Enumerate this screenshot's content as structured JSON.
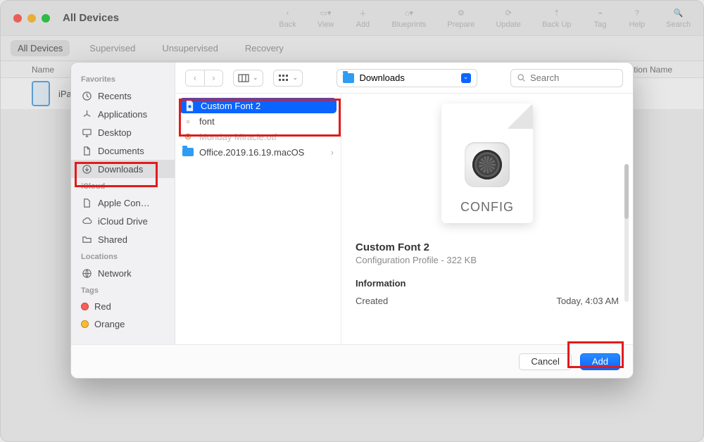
{
  "window": {
    "title": "All Devices",
    "toolbar": {
      "back": "Back",
      "view": "View",
      "add": "Add",
      "blueprints": "Blueprints",
      "prepare": "Prepare",
      "update": "Update",
      "backup": "Back Up",
      "tag": "Tag",
      "help": "Help",
      "search": "Search"
    },
    "scope": {
      "all": "All Devices",
      "supervised": "Supervised",
      "unsupervised": "Unsupervised",
      "recovery": "Recovery"
    },
    "table": {
      "col_name": "Name",
      "col_org": "nization Name",
      "rows": [
        {
          "name": "iPa"
        }
      ]
    }
  },
  "open_panel": {
    "sidebar": {
      "favorites_h": "Favorites",
      "favorites": [
        {
          "label": "Recents",
          "icon": "clock"
        },
        {
          "label": "Applications",
          "icon": "apps"
        },
        {
          "label": "Desktop",
          "icon": "desktop"
        },
        {
          "label": "Documents",
          "icon": "doc"
        },
        {
          "label": "Downloads",
          "icon": "download",
          "selected": true
        }
      ],
      "icloud_h": "iCloud",
      "icloud": [
        {
          "label": "Apple Con…",
          "icon": "doc"
        },
        {
          "label": "iCloud Drive",
          "icon": "cloud"
        },
        {
          "label": "Shared",
          "icon": "folder"
        }
      ],
      "locations_h": "Locations",
      "locations": [
        {
          "label": "Network",
          "icon": "globe"
        }
      ],
      "tags_h": "Tags",
      "tags": [
        {
          "label": "Red",
          "color": "red"
        },
        {
          "label": "Orange",
          "color": "orange"
        }
      ]
    },
    "toolbar": {
      "path": "Downloads",
      "search_placeholder": "Search"
    },
    "file_list": [
      {
        "name": "Custom Font 2",
        "kind": "profile",
        "selected": true
      },
      {
        "name": "font",
        "kind": "image"
      },
      {
        "name": "Monday Miracle.otf",
        "kind": "font"
      },
      {
        "name": "Office.2019.16.19.macOS",
        "kind": "folder"
      }
    ],
    "preview": {
      "config_tag": "CONFIG",
      "title": "Custom Font 2",
      "subtitle": "Configuration Profile - 322 KB",
      "info_h": "Information",
      "created_k": "Created",
      "created_v": "Today, 4:03 AM"
    },
    "buttons": {
      "cancel": "Cancel",
      "add": "Add"
    }
  }
}
